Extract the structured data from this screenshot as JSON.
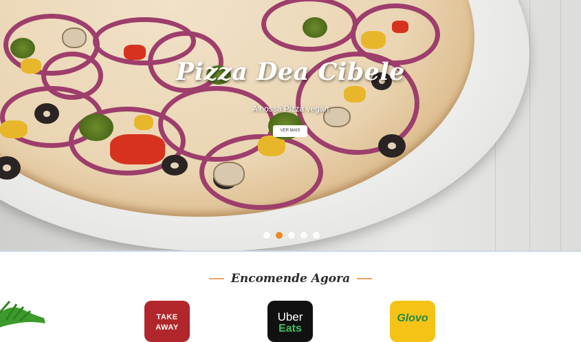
{
  "hero": {
    "title": "Pizza Dea Cibele",
    "subtitle": "A nossa Pizza vegan",
    "button_label": "VER MAIS",
    "slides_count": 5,
    "active_slide_index": 1
  },
  "order": {
    "title": "Encomende Agora",
    "partners": [
      {
        "name": "take-away",
        "line1": "TAKE",
        "line2": "AWAY"
      },
      {
        "name": "uber-eats",
        "line1": "Uber",
        "line2": "Eats"
      },
      {
        "name": "glovo",
        "line1": "Glovo"
      }
    ]
  },
  "colors": {
    "accent": "#f08a24",
    "take_away": "#b0262a",
    "uber": "#111111",
    "glovo": "#f5c316"
  }
}
